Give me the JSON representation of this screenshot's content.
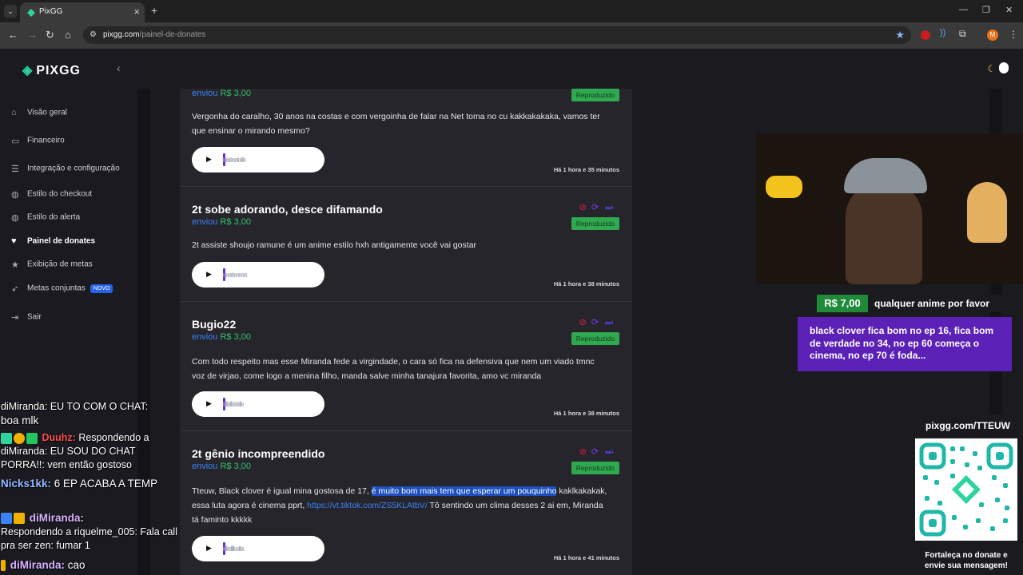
{
  "browser": {
    "tab_title": "PixGG",
    "url_host": "pixgg.com",
    "url_path": "/painel-de-donates",
    "profile_initial": "M"
  },
  "sidebar": {
    "brand": "PIXGG",
    "items": [
      {
        "label": "Visão geral",
        "icon": "home-icon"
      },
      {
        "label": "Financeiro",
        "icon": "wallet-icon"
      },
      {
        "label": "Integração e configuração",
        "icon": "settings-icon"
      },
      {
        "label": "Estilo do checkout",
        "icon": "palette-icon"
      },
      {
        "label": "Estilo do alerta",
        "icon": "palette-icon"
      },
      {
        "label": "Painel de donates",
        "icon": "donate-icon"
      },
      {
        "label": "Exibição de metas",
        "icon": "star-icon"
      },
      {
        "label": "Metas conjuntas",
        "icon": "rocket-icon",
        "badge": "NOVO"
      },
      {
        "label": "Sair",
        "icon": "logout-icon"
      }
    ]
  },
  "feed": {
    "sent_label": "enviou",
    "status": "Reproduzido",
    "cards": [
      {
        "name": "",
        "amount": "R$ 3,00",
        "message": "Vergonha do caralho, 30 anos na costas e com vergoinha de falar na Net toma no cu kakkakakaka, vamos ter que ensinar o mirando mesmo?",
        "time": "Há 1 hora e 35 minutos"
      },
      {
        "name": "2t sobe adorando, desce difamando",
        "amount": "R$ 3,00",
        "message": "2t assiste shoujo ramune é um anime estilo hxh antigamente você vai gostar",
        "time": "Há 1 hora e 38 minutos"
      },
      {
        "name": "Bugio22",
        "amount": "R$ 3,00",
        "message": "Com todo respeito mas esse Miranda fede a virgindade, o cara só fica na defensiva que nem um viado tmnc voz de virjao, come logo a menina filho, manda salve minha tanajura favorita, amo vc miranda",
        "time": "Há 1 hora e 38 minutos"
      },
      {
        "name": "2t gênio incompreendido",
        "amount": "R$ 3,00",
        "message_a": "Tteuw, Black clover é igual mina gostosa de 17, ",
        "message_hl": "é muito bom mais tem que esperar um pouquinho",
        "message_b": " kaklkakakak, essa luta agora é cinema pprt, ",
        "message_link": "https://vt.tiktok.com/ZS5KLAtbV/",
        "message_c": " Tô sentindo um clima desses 2 ai em, Miranda tá faminto kkkkk",
        "time": "Há 1 hora e 41 minutos"
      }
    ]
  },
  "overlay": {
    "donation_amount": "R$ 7,00",
    "donation_title": "qualquer anime por favor",
    "donation_message": "black clover fica bom no ep 16, fica bom de verdade no 34, no ep 60 começa o cinema, no ep 70 é foda...",
    "qr_url": "pixgg.com/TTEUW",
    "qr_caption": "Fortaleça no donate e envie sua mensagem!"
  },
  "chat": [
    {
      "text": "diMiranda: EU TO COM O CHAT:"
    },
    {
      "text": "boa mlk"
    },
    {
      "user": "Duuhz:",
      "text": " Respondendo a diMiranda: EU SOU DO CHAT PORRA!!: vem então gostoso"
    },
    {
      "user": "Nicks1kk:",
      "text": " 6 EP ACABA A TEMP"
    },
    {
      "user": "diMiranda:",
      "text": ""
    },
    {
      "text": "Respondendo a riquelme_005: Fala call pra ser zen:  fumar 1"
    },
    {
      "user": "diMiranda:",
      "text": " cao"
    }
  ]
}
